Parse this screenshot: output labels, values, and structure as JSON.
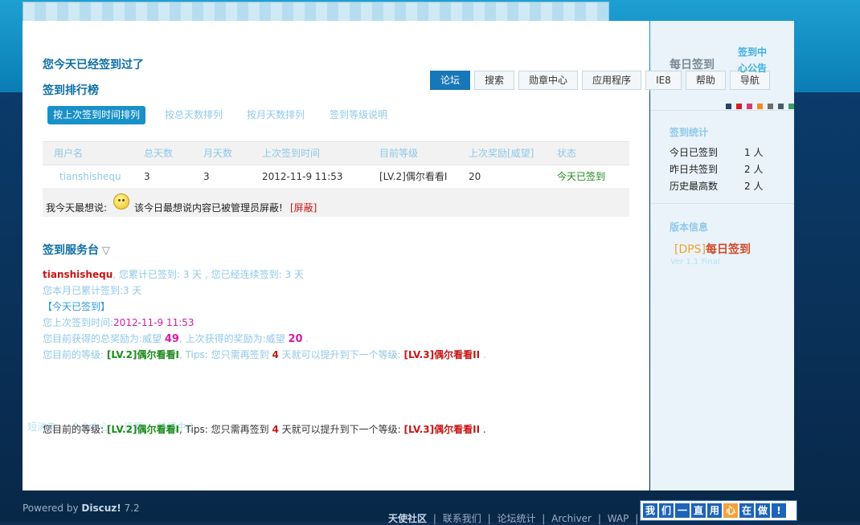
{
  "notice": "您今天已经签到过了",
  "ranking_title": "签到排行榜",
  "nav": [
    "论坛",
    "搜索",
    "勋章中心",
    "应用程序",
    "IE8",
    "帮助",
    "导航"
  ],
  "sort_tabs": [
    "按上次签到时间排列",
    "按总天数排列",
    "按月天数排列",
    "签到等级说明"
  ],
  "table": {
    "headers": [
      "用户名",
      "总天数",
      "月天数",
      "上次签到时间",
      "目前等级",
      "上次奖励[威望]",
      "状态"
    ],
    "row": {
      "user": "tianshishequ",
      "total": "3",
      "month": "3",
      "last": "2012-11-9 11:53",
      "level": "[LV.2]偶尔看看I",
      "reward": "20",
      "status": "今天已签到"
    }
  },
  "mood": {
    "prefix": "我今天最想说:",
    "text": "该今日最想说内容已被管理员屏蔽!",
    "tag": "[屏蔽]"
  },
  "service": {
    "title": "签到服务台",
    "arrow": "▽",
    "user": "tianshishequ",
    "line1_rest": ", 您累计已签到: 3 天 , 您已经连续签到: 3 天",
    "line2": "您本月已累计签到:3 天",
    "line3": "【今天已签到】",
    "line4_label": "您上次签到时间:",
    "line4_time": "2012-11-9 11:53",
    "line5_a": "您目前获得的总奖励为:威望",
    "line5_total": "49",
    "line5_b": ", 上次获得的奖励为:威望",
    "line5_last": "20",
    "line5_c": ".",
    "line6_a": "您目前的等级:",
    "level_now": "[LV.2]偶尔看看I",
    "line6_b": ", Tips: 您只需再签到",
    "days_left": "4",
    "line6_c": "天就可以提升到下一个等级:",
    "level_next": "[LV.3]偶尔看看II",
    "line6_d": "."
  },
  "repeat_line": {
    "a": "您目前的等级:",
    "level_now": "[LV.2]偶尔看看I",
    "b": ", Tips: 您只需再签到",
    "days_left": "4",
    "c": "天就可以提升到下一个等级:",
    "level_next": "[LV.3]偶尔看看II",
    "d": "."
  },
  "overlap_links": [
    "短消息",
    "个人中心",
    "设置",
    "管理中心"
  ],
  "sidebar": {
    "title": "每日签到",
    "notice_link_1": "签到中",
    "notice_link_2": "心公告",
    "stats_title": "签到统计",
    "stats": [
      {
        "label": "今日已签到",
        "value": "1 人"
      },
      {
        "label": "昨日共签到",
        "value": "2 人"
      },
      {
        "label": "历史最高数",
        "value": "2 人"
      }
    ],
    "version_title": "版本信息",
    "brand_tag": "[DPS]",
    "brand_name": "每日签到",
    "version": "Ver 1.1 Final",
    "swatches": [
      "#27406d",
      "#d41e2a",
      "#d83c6e",
      "#f08d20",
      "#6f6f6f",
      "#4c5a6a",
      "#3c9a6b"
    ]
  },
  "footer": {
    "powered": "Powered by",
    "brand": "Discuz!",
    "version": "7.2",
    "links": [
      "天使社区",
      "联系我们",
      "论坛统计",
      "Archiver",
      "WAP"
    ],
    "banner_chars": [
      "我",
      "们",
      "一",
      "直",
      "用",
      "心",
      "在",
      "做",
      "!"
    ]
  },
  "colors": {
    "accent": "#1777b8",
    "title_blue": "#0d6fa5",
    "link_light": "#8fc8e8",
    "red": "#c81414",
    "green": "#1a8a1a",
    "magenta": "#d01fa8"
  }
}
